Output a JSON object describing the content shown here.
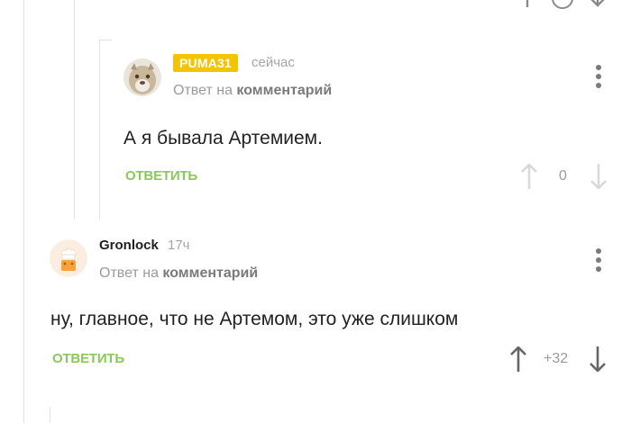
{
  "comments": [
    {
      "username": "PUMA31",
      "time": "сейчас",
      "reply_prefix": "Ответ на",
      "reply_target": "комментарий",
      "text": "А я бывала Артемием.",
      "reply_label": "ОТВЕТИТЬ",
      "rating": "0",
      "badge_color": "#f5c400"
    },
    {
      "username": "Gronlock",
      "time": "17ч",
      "reply_prefix": "Ответ на",
      "reply_target": "комментарий",
      "text": "ну, главное, что не Артемом, это уже слишком",
      "reply_label": "ОТВЕТИТЬ",
      "rating": "+32"
    }
  ],
  "colors": {
    "accent_green": "#8ac858",
    "badge_yellow": "#f5c400",
    "muted": "#9a9a9a"
  },
  "icons": [
    "upvote-icon",
    "downvote-icon",
    "more-options-icon",
    "avatar-puma",
    "avatar-chef"
  ]
}
